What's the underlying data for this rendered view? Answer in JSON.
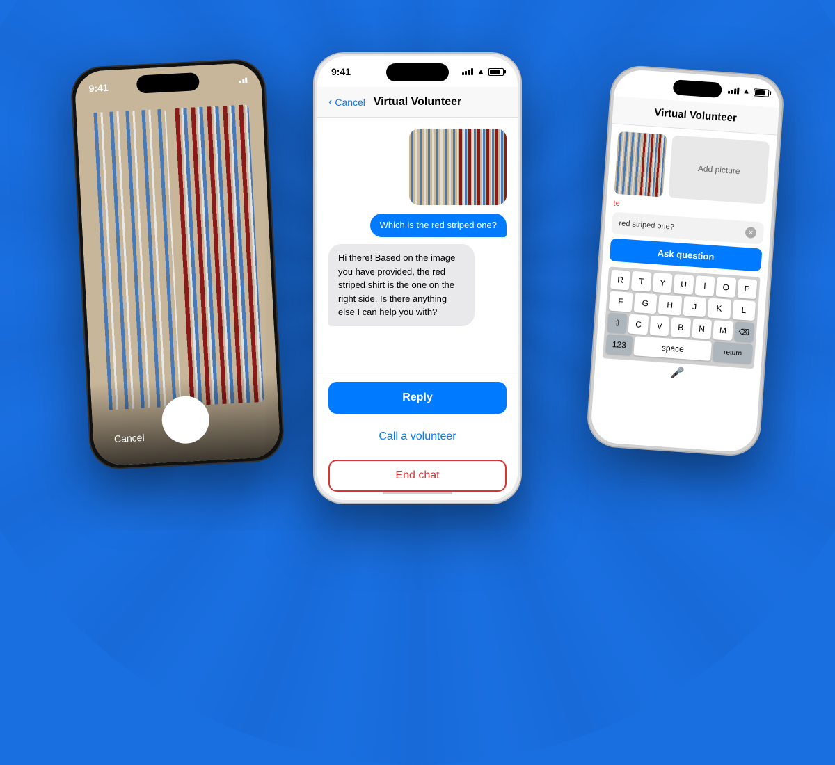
{
  "background": {
    "color": "#1a6fe0"
  },
  "phone_left": {
    "time": "9:41",
    "cancel_label": "Cancel",
    "camera": true
  },
  "phone_center": {
    "time": "9:41",
    "nav": {
      "back_label": "Cancel",
      "title": "Virtual Volunteer"
    },
    "chat": {
      "user_message": "Which is the red striped one?",
      "bot_message": "Hi there! Based on the image you have provided, the red striped shirt is the one on the right side. Is there anything else I can help you with?"
    },
    "buttons": {
      "reply": "Reply",
      "call_volunteer": "Call a volunteer",
      "end_chat": "End chat"
    }
  },
  "phone_right": {
    "title": "Virtual Volunteer",
    "add_picture_label": "Add picture",
    "input_text": "red striped one?",
    "ask_button": "Ask question",
    "keyboard": {
      "row1": [
        "R",
        "T",
        "Y",
        "U",
        "I",
        "O",
        "P"
      ],
      "row2": [
        "F",
        "G",
        "H",
        "J",
        "K",
        "L"
      ],
      "row3": [
        "C",
        "V",
        "B",
        "N",
        "M"
      ],
      "space_label": "space",
      "return_label": "return"
    }
  }
}
